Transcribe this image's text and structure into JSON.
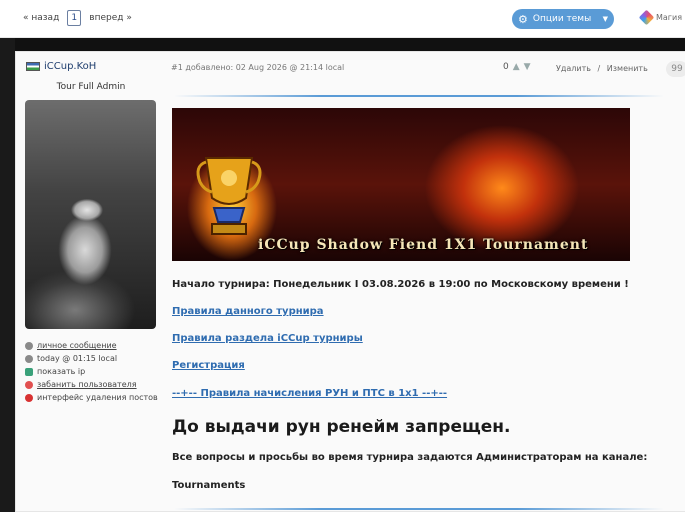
{
  "nav": {
    "prev_label": "« назад",
    "page_number": "1",
    "next_label": "вперед »",
    "topic_options_label": "Опции темы",
    "magic_label": "Магия"
  },
  "post": {
    "author": {
      "name": "iCCup.KoH",
      "title": "Tour Full Admin",
      "links": [
        {
          "label": "личное сообщение",
          "icon": "message-icon",
          "color": "#8a8a8a"
        },
        {
          "label": "today @ 01:15 local",
          "icon": "clock-icon",
          "color": "#8a8a8a"
        },
        {
          "label": "показать ip",
          "icon": "ip-icon",
          "color": "#3aa17a"
        },
        {
          "label": "забанить пользователя",
          "icon": "ban-icon",
          "color": "#e15050"
        },
        {
          "label": "интерфейс удаления постов",
          "icon": "delete-icon",
          "color": "#d83232"
        }
      ]
    },
    "meta": "#1 добавлено: 02 Aug 2026 @ 21:14 local",
    "vote_count": "0",
    "delete_label": "Удалить",
    "actions_separator": "/",
    "edit_label": "Изменить",
    "quote_label": "99",
    "banner_title": "iCCup Shadow Fiend 1X1 Tournament",
    "start_text": "Начало турнира: Понедельник I 03.08.2026 в 19:00 по Московскому времени !",
    "link_rules_tournament": "Правила данного турнира",
    "link_rules_section": "Правила раздела iCCup турниры",
    "link_registration": "Регистрация",
    "link_rune_rules": "--+-- Правила начисления РУН и ПТС в 1x1 --+--",
    "headline": "До выдачи рун ренейм запрещен.",
    "questions_text": "Все вопросы и просьбы во время турнира задаются Администраторам на канале:",
    "channel": "Tournaments"
  },
  "colors": {
    "accent": "#5a9bd6",
    "link": "#2f6cb0"
  }
}
